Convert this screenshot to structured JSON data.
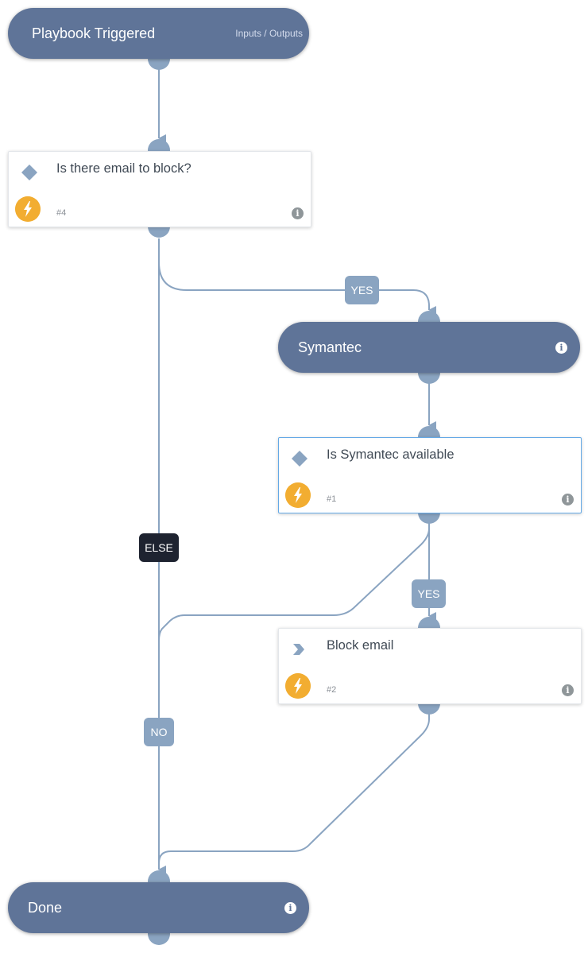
{
  "playbook": {
    "start_node": {
      "title": "Playbook Triggered",
      "link": "Inputs / Outputs"
    },
    "end_node": {
      "title": "Done",
      "icon": "info-icon"
    },
    "section_nodes": [
      {
        "title": "Symantec",
        "icon": "info-icon"
      }
    ],
    "task_nodes": [
      {
        "name": "Is there email to block?",
        "id": "#4",
        "type": "condition",
        "type_icon": "diamond-icon",
        "status_icon": "lightning-bolt-icon"
      },
      {
        "name": "Is Symantec available",
        "id": "#1",
        "type": "condition",
        "type_icon": "diamond-icon",
        "status_icon": "lightning-bolt-icon",
        "selected": true
      },
      {
        "name": "Block email",
        "id": "#2",
        "type": "playbook",
        "type_icon": "chevron-right-icon",
        "status_icon": "lightning-bolt-icon"
      }
    ],
    "edge_labels": {
      "yes_1": "YES",
      "yes_2": "YES",
      "else": "ELSE",
      "no": "NO"
    },
    "colors": {
      "node_fill": "#5f7498",
      "edge": "#8aa4c1",
      "bolt": "#f2ad31",
      "else_label": "#1e2330",
      "selected_border": "#64a9e6"
    }
  }
}
